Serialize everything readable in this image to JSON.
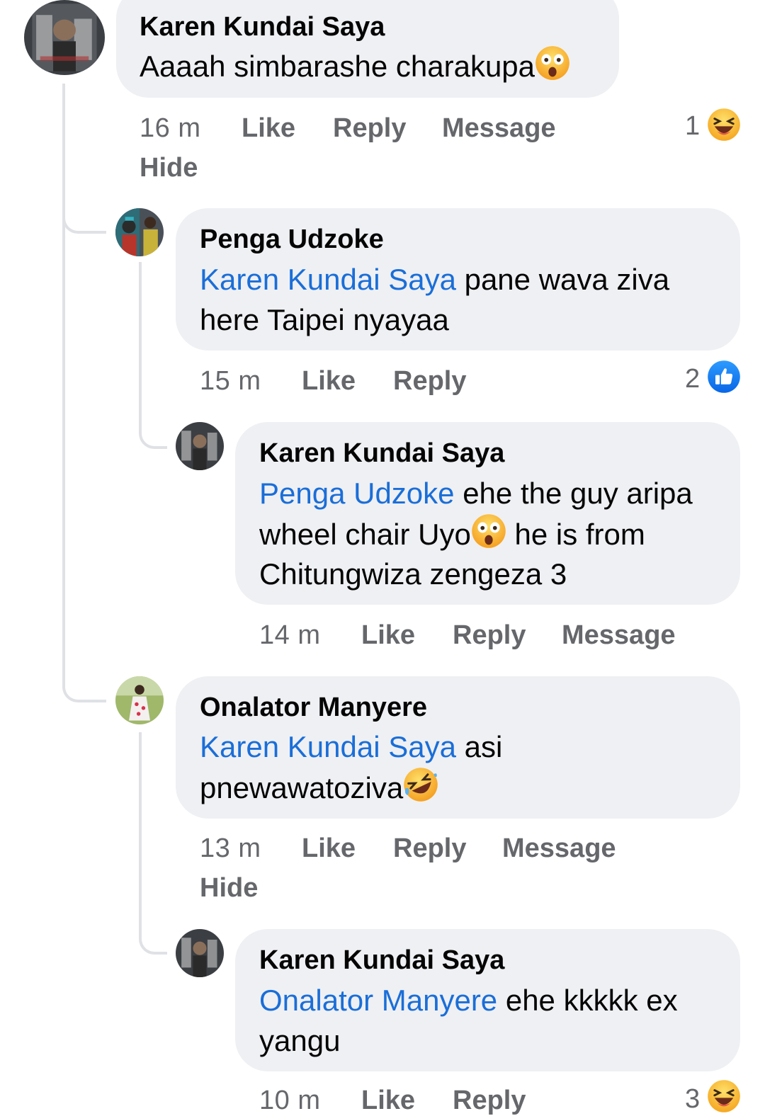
{
  "comments": [
    {
      "author": "Karen Kundai Saya",
      "text": "Aaaah simbarashe charakupa",
      "emoji": "astonished-face",
      "time": "16 m",
      "like": "Like",
      "reply": "Reply",
      "message": "Message",
      "hide": "Hide",
      "reaction_count": "1",
      "reaction": "laughing-face"
    },
    {
      "author": "Penga Udzoke",
      "mention": "Karen Kundai Saya",
      "text_line1": " pane wava ziva",
      "text_line2": "here Taipei nyayaa",
      "time": "15 m",
      "like": "Like",
      "reply": "Reply",
      "reaction_count": "2",
      "reaction": "thumbs-up-like"
    },
    {
      "author": "Karen Kundai Saya",
      "mention": "Penga Udzoke",
      "text_line1": " ehe the guy aripa",
      "text_line2a": "wheel chair Uyo",
      "text_line2b": " he is from",
      "text_line3": "Chitungwiza zengeza 3",
      "emoji": "astonished-face",
      "time": "14 m",
      "like": "Like",
      "reply": "Reply",
      "message": "Message"
    },
    {
      "author": "Onalator Manyere",
      "mention": "Karen Kundai Saya",
      "text_line1": " asi",
      "text_line2": "pnewawatoziva",
      "emoji": "rolling-laughing-face",
      "time": "13 m",
      "like": "Like",
      "reply": "Reply",
      "message": "Message",
      "hide": "Hide"
    },
    {
      "author": "Karen Kundai Saya",
      "mention": "Onalator Manyere",
      "text_line1": " ehe kkkkk ex",
      "text_line2": "yangu",
      "time": "10 m",
      "like": "Like",
      "reply": "Reply",
      "reaction_count": "3",
      "reaction": "laughing-face"
    }
  ],
  "colors": {
    "bubble": "#eff0f3",
    "mention": "#1a6ed8",
    "meta": "#65676b",
    "thread_line": "#dfe1e5"
  }
}
